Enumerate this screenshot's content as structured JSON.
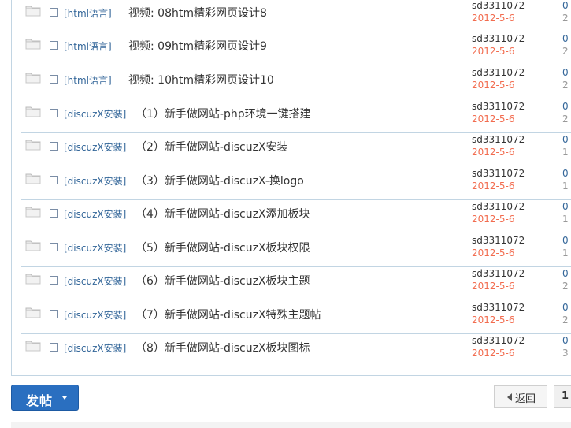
{
  "threads": [
    {
      "category": "[html语言]",
      "title": "视频: 08htm精彩网页设计8",
      "author": "sd3311072",
      "date": "2012-5-6",
      "replies": "0",
      "views": "2"
    },
    {
      "category": "[html语言]",
      "title": "视频: 09htm精彩网页设计9",
      "author": "sd3311072",
      "date": "2012-5-6",
      "replies": "0",
      "views": "2"
    },
    {
      "category": "[html语言]",
      "title": "视频: 10htm精彩网页设计10",
      "author": "sd3311072",
      "date": "2012-5-6",
      "replies": "0",
      "views": "2"
    },
    {
      "category": "[discuzX安装]",
      "title": "（1）新手做网站-php环境一键搭建",
      "author": "sd3311072",
      "date": "2012-5-6",
      "replies": "0",
      "views": "2"
    },
    {
      "category": "[discuzX安装]",
      "title": "（2）新手做网站-discuzX安装",
      "author": "sd3311072",
      "date": "2012-5-6",
      "replies": "0",
      "views": "1"
    },
    {
      "category": "[discuzX安装]",
      "title": "（3）新手做网站-discuzX-换logo",
      "author": "sd3311072",
      "date": "2012-5-6",
      "replies": "0",
      "views": "1"
    },
    {
      "category": "[discuzX安装]",
      "title": "（4）新手做网站-discuzX添加板块",
      "author": "sd3311072",
      "date": "2012-5-6",
      "replies": "0",
      "views": "1"
    },
    {
      "category": "[discuzX安装]",
      "title": "（5）新手做网站-discuzX板块权限",
      "author": "sd3311072",
      "date": "2012-5-6",
      "replies": "0",
      "views": "1"
    },
    {
      "category": "[discuzX安装]",
      "title": "（6）新手做网站-discuzX板块主题",
      "author": "sd3311072",
      "date": "2012-5-6",
      "replies": "0",
      "views": "2"
    },
    {
      "category": "[discuzX安装]",
      "title": "（7）新手做网站-discuzX特殊主题帖",
      "author": "sd3311072",
      "date": "2012-5-6",
      "replies": "0",
      "views": "2"
    },
    {
      "category": "[discuzX安装]",
      "title": "（8）新手做网站-discuzX板块图标",
      "author": "sd3311072",
      "date": "2012-5-6",
      "replies": "0",
      "views": "3"
    }
  ],
  "toolbar": {
    "post_label": "发帖",
    "back_label": "返回",
    "current_page": "1"
  },
  "colors": {
    "accent": "#2a6fc0",
    "category_link": "#336699",
    "date": "#f26c4f",
    "border": "#c2d5e3"
  }
}
